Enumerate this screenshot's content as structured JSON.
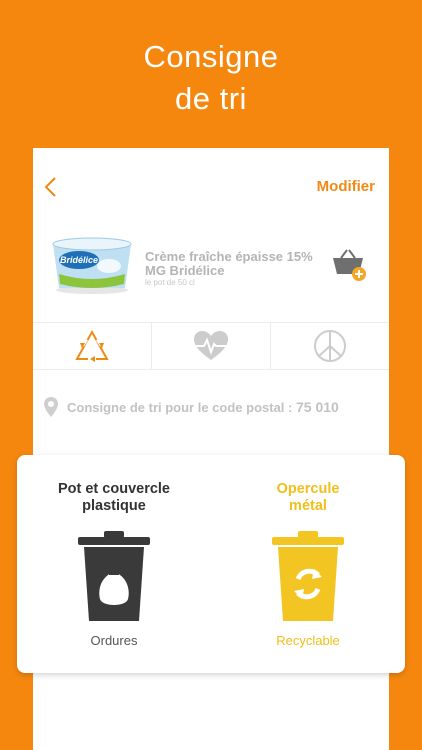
{
  "header": {
    "title_line1": "Consigne",
    "title_line2": "de tri"
  },
  "topbar": {
    "modify_label": "Modifier"
  },
  "product": {
    "name_line1": "Crème fraîche épaisse 15%",
    "name_line2": "MG Bridélice",
    "size": "le pot de 50 cl",
    "brand_logo": "Bridélice"
  },
  "tabs": [
    {
      "icon": "recycle-icon",
      "active": true
    },
    {
      "icon": "heart-pulse-icon",
      "active": false
    },
    {
      "icon": "peace-icon",
      "active": false
    }
  ],
  "location": {
    "prefix": "Consigne de tri pour le code postal :",
    "postal_code": "75 010"
  },
  "sorting": [
    {
      "title_line1": "Pot et couvercle",
      "title_line2": "plastique",
      "bin_label": "Ordures",
      "bin_color": "#3a3a3a"
    },
    {
      "title_line1": "Opercule",
      "title_line2": "métal",
      "bin_label": "Recyclable",
      "bin_color": "#f2c523"
    }
  ],
  "colors": {
    "brand": "#f5870f",
    "accent": "#f08a14",
    "recycle": "#f2c523",
    "trash": "#3a3a3a"
  }
}
